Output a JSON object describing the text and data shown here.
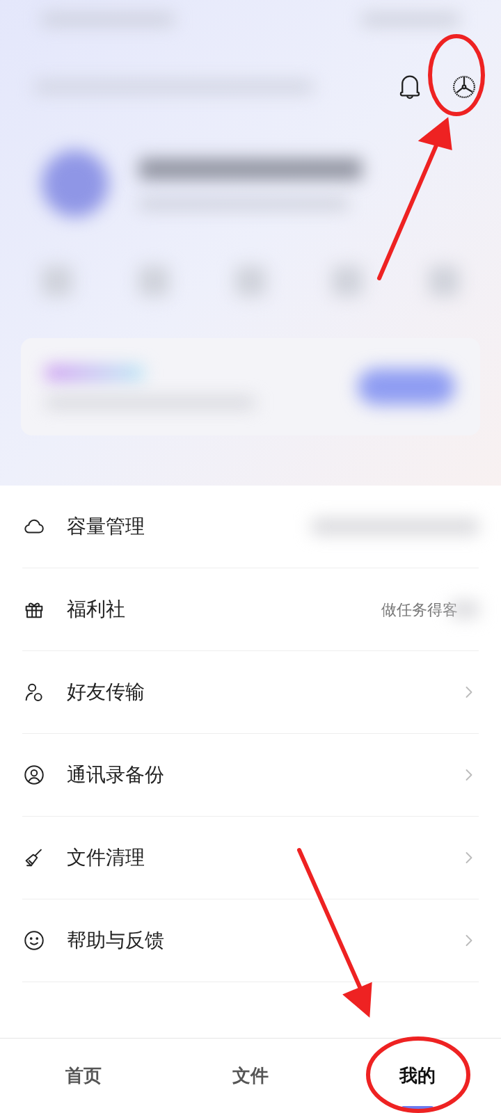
{
  "menu": [
    {
      "kind": "cloud",
      "label": "容量管理",
      "blurred": true,
      "chevron": false
    },
    {
      "kind": "gift",
      "label": "福利社",
      "hint": "做任务得客",
      "blurred": true,
      "chevron": false
    },
    {
      "kind": "friend",
      "label": "好友传输",
      "blurred": false,
      "chevron": true
    },
    {
      "kind": "contact",
      "label": "通讯录备份",
      "blurred": false,
      "chevron": true
    },
    {
      "kind": "broom",
      "label": "文件清理",
      "blurred": false,
      "chevron": true
    },
    {
      "kind": "smile",
      "label": "帮助与反馈",
      "blurred": false,
      "chevron": true
    }
  ],
  "nav": [
    {
      "label": "首页",
      "selected": false
    },
    {
      "label": "文件",
      "selected": false
    },
    {
      "label": "我的",
      "selected": true
    }
  ]
}
